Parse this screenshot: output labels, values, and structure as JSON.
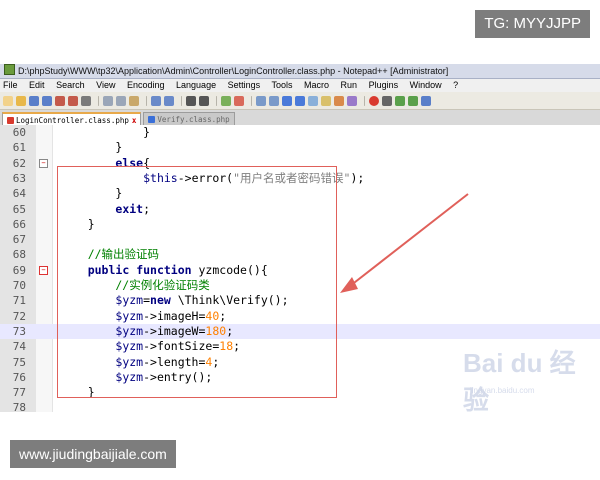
{
  "watermarks": {
    "top_right": "TG: MYYJJPP",
    "bottom_left": "www.jiudingbaijiale.com"
  },
  "window": {
    "title": "D:\\phpStudy\\WWW\\tp32\\Application\\Admin\\Controller\\LoginController.class.php - Notepad++ [Administrator]"
  },
  "menu": [
    "File",
    "Edit",
    "Search",
    "View",
    "Encoding",
    "Language",
    "Settings",
    "Tools",
    "Macro",
    "Run",
    "Plugins",
    "Window",
    "?"
  ],
  "tabs": [
    {
      "label": "LoginController.class.php",
      "active": true
    },
    {
      "label": "Verify.class.php",
      "active": false
    }
  ],
  "colors": {
    "keyword": "#000080",
    "comment": "#008000",
    "number": "#ff8000",
    "highlight_line": "#e8e8ff",
    "annotation": "#e0605a"
  },
  "lines": [
    {
      "n": "60",
      "text": "            }"
    },
    {
      "n": "61",
      "text": "        }"
    },
    {
      "n": "62",
      "text": "        else{"
    },
    {
      "n": "63",
      "text": "            $this->error(\"用户名或者密码错误\");"
    },
    {
      "n": "64",
      "text": "        }"
    },
    {
      "n": "65",
      "text": "        exit;"
    },
    {
      "n": "66",
      "text": "    }"
    },
    {
      "n": "67",
      "text": ""
    },
    {
      "n": "68",
      "text": "    //输出验证码"
    },
    {
      "n": "69",
      "text": "    public function yzmcode(){"
    },
    {
      "n": "70",
      "text": "        //实例化验证码类"
    },
    {
      "n": "71",
      "text": "        $yzm=new \\Think\\Verify();"
    },
    {
      "n": "72",
      "text": "        $yzm->imageH=40;"
    },
    {
      "n": "73",
      "text": "        $yzm->imageW=180;"
    },
    {
      "n": "74",
      "text": "        $yzm->fontSize=18;"
    },
    {
      "n": "75",
      "text": "        $yzm->length=4;"
    },
    {
      "n": "76",
      "text": "        $yzm->entry();"
    },
    {
      "n": "77",
      "text": "    }"
    },
    {
      "n": "78",
      "text": ""
    }
  ],
  "baidu_mark": "Bai du 经验",
  "baidu_sub": "jingyan.baidu.com"
}
